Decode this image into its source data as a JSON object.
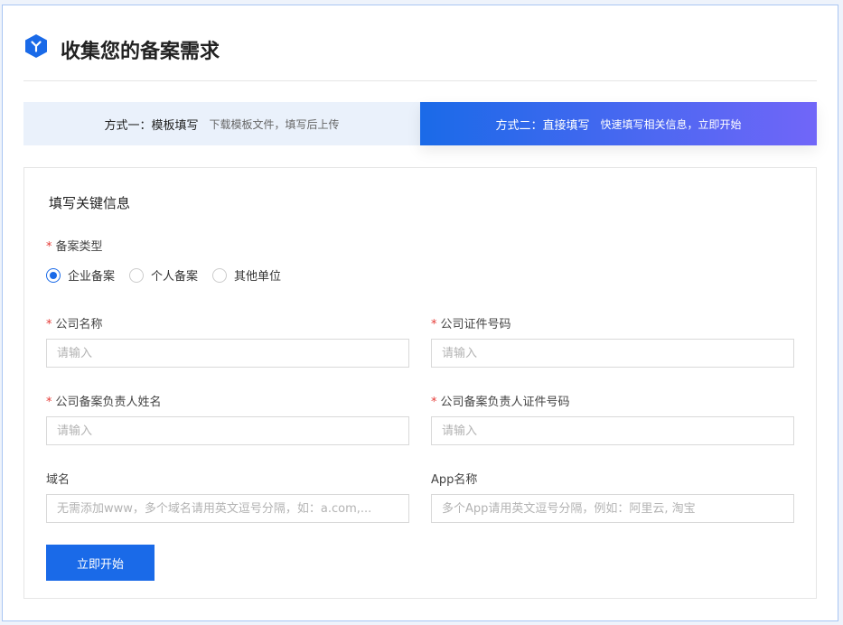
{
  "header": {
    "title": "收集您的备案需求",
    "icon": "hexagon-logo-icon"
  },
  "tabs": [
    {
      "label": "方式一：模板填写",
      "sub": "下载模板文件，填写后上传"
    },
    {
      "label": "方式二：直接填写",
      "sub": "快速填写相关信息，立即开始"
    }
  ],
  "form": {
    "section_title": "填写关键信息",
    "type": {
      "label": "备案类型",
      "required": "*",
      "options": [
        "企业备案",
        "个人备案",
        "其他单位"
      ],
      "selected": "企业备案"
    },
    "fields": [
      {
        "label": "公司名称",
        "required": "*",
        "placeholder": "请输入",
        "value": ""
      },
      {
        "label": "公司证件号码",
        "required": "*",
        "placeholder": "请输入",
        "value": ""
      },
      {
        "label": "公司备案负责人姓名",
        "required": "*",
        "placeholder": "请输入",
        "value": ""
      },
      {
        "label": "公司备案负责人证件号码",
        "required": "*",
        "placeholder": "请输入",
        "value": ""
      },
      {
        "label": "域名",
        "placeholder": "无需添加www，多个域名请用英文逗号分隔，如：a.com,...",
        "value": ""
      },
      {
        "label": "App名称",
        "placeholder": "多个App请用英文逗号分隔，例如：阿里云, 淘宝",
        "value": ""
      }
    ],
    "submit": "立即开始"
  },
  "colors": {
    "accent": "#1a6ae8",
    "gradient_end": "#7166f8",
    "required": "#e53935"
  }
}
